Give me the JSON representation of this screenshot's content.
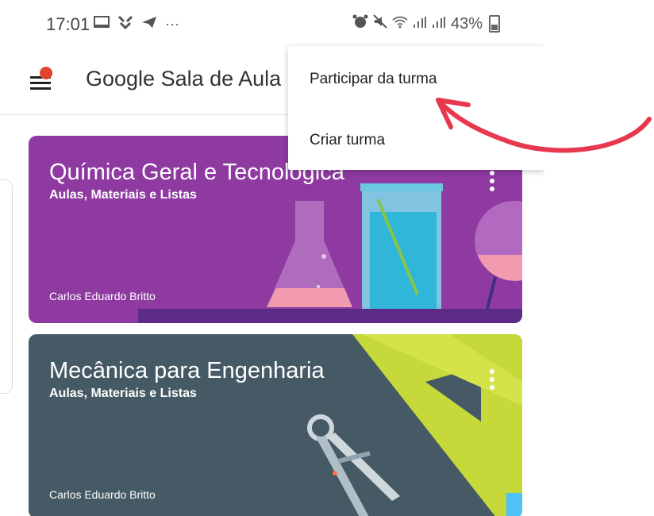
{
  "status_bar": {
    "time": "17:01",
    "left_icons": [
      "cast-icon",
      "notification-icon",
      "telegram-icon",
      "more-notifications-icon"
    ],
    "ellipsis": "···",
    "right_icons": [
      "alarm-icon",
      "mute-icon",
      "wifi-icon",
      "signal-icon",
      "signal-icon"
    ],
    "battery": "43%"
  },
  "app_bar": {
    "title": "Google Sala de Aula"
  },
  "menu": {
    "items": [
      {
        "label": "Participar da turma"
      },
      {
        "label": "Criar turma"
      }
    ]
  },
  "classes": [
    {
      "title": "Química Geral e Tecnológica",
      "subtitle": "Aulas, Materiais e Listas",
      "teacher": "Carlos Eduardo Britto",
      "color": "#8e3aa1"
    },
    {
      "title": "Mecânica para Engenharia",
      "subtitle": "Aulas, Materiais e Listas",
      "teacher": "Carlos Eduardo Britto",
      "color": "#455a64"
    }
  ],
  "annotation": {
    "color": "#e8384f"
  }
}
